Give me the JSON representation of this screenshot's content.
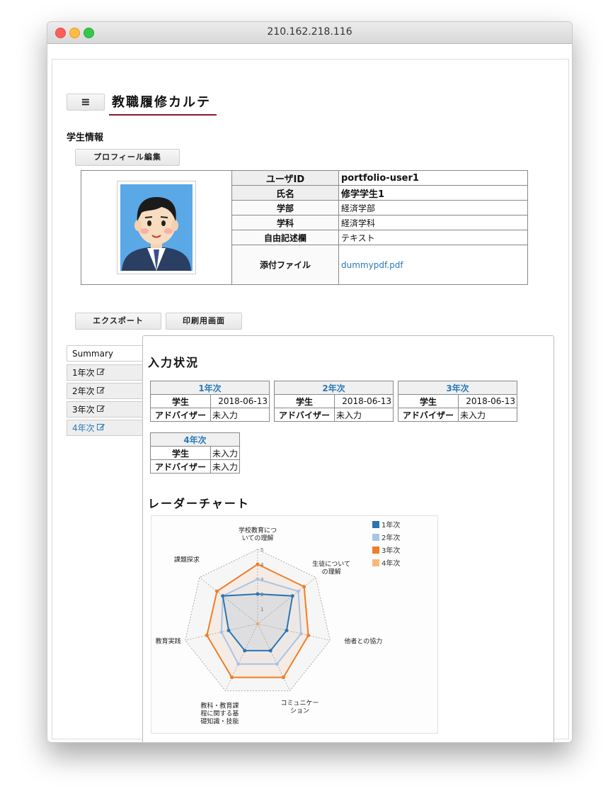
{
  "window": {
    "title": "210.162.218.116"
  },
  "app": {
    "menu_icon": "≡",
    "title": "教職履修カルテ"
  },
  "student_section": {
    "label": "学生情報",
    "edit_button": "プロフィール編集"
  },
  "profile": {
    "rows": [
      {
        "key": "ユーザID",
        "value": "portfolio-user1"
      },
      {
        "key": "氏名",
        "value": "修学学生1"
      },
      {
        "key": "学部",
        "value": "経済学部"
      },
      {
        "key": "学科",
        "value": "経済学科"
      },
      {
        "key": "自由記述欄",
        "value": "テキスト"
      },
      {
        "key": "添付ファイル",
        "value": "dummypdf.pdf"
      }
    ]
  },
  "actions": {
    "export": "エクスポート",
    "print": "印刷用画面"
  },
  "tabs": [
    {
      "label": "Summary",
      "icon": ""
    },
    {
      "label": "1年次",
      "icon": "edit-icon"
    },
    {
      "label": "2年次",
      "icon": "edit-icon"
    },
    {
      "label": "3年次",
      "icon": "edit-icon"
    },
    {
      "label": "4年次",
      "icon": "edit-icon"
    }
  ],
  "input_status": {
    "title": "入力状況",
    "student_label": "学生",
    "advisor_label": "アドバイザー",
    "years": [
      {
        "year": "1年次",
        "student": "2018-06-13",
        "advisor": "未入力"
      },
      {
        "year": "2年次",
        "student": "2018-06-13",
        "advisor": "未入力"
      },
      {
        "year": "3年次",
        "student": "2018-06-13",
        "advisor": "未入力"
      },
      {
        "year": "4年次",
        "student": "未入力",
        "advisor": "未入力"
      }
    ]
  },
  "radar": {
    "title": "レーダーチャート"
  },
  "chart_data": {
    "type": "radar",
    "axes": [
      [
        "学校教育につ",
        "いての理解"
      ],
      [
        "生徒について",
        "の理解"
      ],
      [
        "他者との協力"
      ],
      [
        "コミュニケー",
        "ション"
      ],
      [
        "教科・教育課",
        "程に関する基",
        "礎知識・技能"
      ],
      [
        "教育実践"
      ],
      [
        "課題探求"
      ]
    ],
    "rmax": 5,
    "tick_labels": [
      "1",
      "2",
      "3",
      "4",
      "5"
    ],
    "series": [
      {
        "name": "1年次",
        "color": "#2b75b3",
        "values": [
          2,
          3,
          2,
          2,
          2,
          2,
          3
        ]
      },
      {
        "name": "2年次",
        "color": "#a9c4e6",
        "values": [
          3,
          3.5,
          3,
          3,
          3,
          2.5,
          3
        ]
      },
      {
        "name": "3年次",
        "color": "#f07e26",
        "values": [
          4,
          4,
          3.5,
          4,
          4,
          3.5,
          3.5
        ]
      },
      {
        "name": "4年次",
        "color": "#f7b97b",
        "values": [
          0,
          0,
          0,
          0,
          0,
          0,
          0
        ]
      }
    ],
    "legend_position": "top-right"
  }
}
